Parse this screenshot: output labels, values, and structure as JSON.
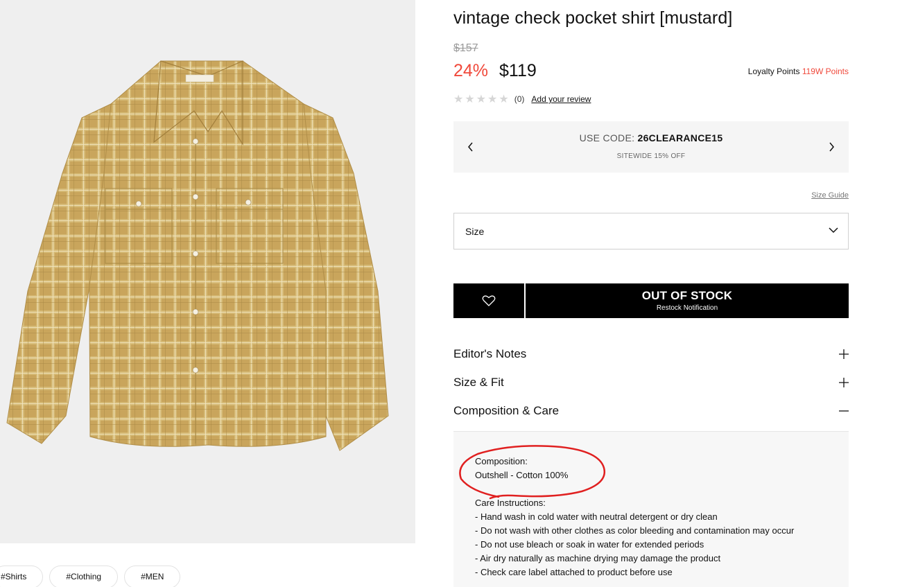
{
  "product": {
    "title": "vintage check pocket shirt [mustard]",
    "original_price": "$157",
    "discount": "24%",
    "price": "$119",
    "loyalty_label": "Loyalty Points",
    "loyalty_points": "119W Points",
    "review_count": "(0)",
    "add_review": "Add your review",
    "rating_stars": 0,
    "image_icon": "plaid-shirt-image"
  },
  "promo": {
    "code_label": "USE CODE:",
    "code": "26CLEARANCE15",
    "subtitle": "SITEWIDE 15% OFF"
  },
  "size": {
    "guide_label": "Size Guide",
    "select_label": "Size"
  },
  "actions": {
    "status": "OUT OF STOCK",
    "restock": "Restock Notification"
  },
  "accordion": [
    {
      "label": "Editor's Notes",
      "expanded": false
    },
    {
      "label": "Size & Fit",
      "expanded": false
    },
    {
      "label": "Composition & Care",
      "expanded": true
    }
  ],
  "care": {
    "composition_title": "Composition:",
    "composition_value": "Outshell - Cotton 100%",
    "instructions_title": "Care Instructions:",
    "instructions": [
      "- Hand wash in cold water with neutral detergent or dry clean",
      "- Do not wash with other clothes as color bleeding and contamination may occur",
      "- Do not use bleach or soak in water for extended periods",
      "- Air dry naturally as machine drying may damage the product",
      "- Check care label attached to product before use"
    ]
  },
  "tags": [
    "#Shirts",
    "#Clothing",
    "#MEN"
  ],
  "colors": {
    "accent": "#f0493b",
    "shirt": "#c9a55c",
    "annotation": "#e02020"
  }
}
